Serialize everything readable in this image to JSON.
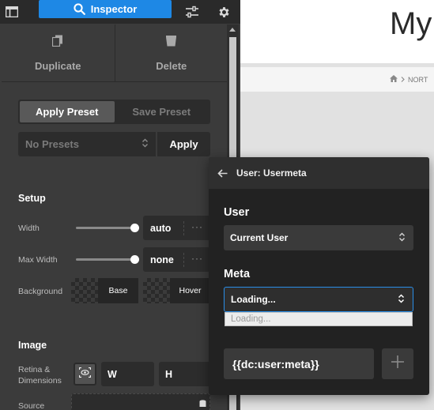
{
  "topbar": {
    "layout_icon": "layout-icon",
    "inspector_label": "Inspector",
    "sliders_icon": "sliders-icon",
    "gear_icon": "gear-icon"
  },
  "actions": {
    "duplicate_label": "Duplicate",
    "delete_label": "Delete"
  },
  "presets": {
    "apply_tab": "Apply Preset",
    "save_tab": "Save Preset",
    "select_value": "No Presets",
    "apply_button": "Apply"
  },
  "setup": {
    "heading": "Setup",
    "width_label": "Width",
    "width_value": "auto",
    "max_width_label": "Max Width",
    "max_width_value": "none",
    "more_dots": "···",
    "background_label": "Background",
    "base_label": "Base",
    "hover_label": "Hover"
  },
  "image": {
    "heading": "Image",
    "retina_label": "Retina & Dimensions",
    "w_placeholder": "W",
    "h_placeholder": "H",
    "source_label": "Source"
  },
  "canvas": {
    "title_partial": "My",
    "crumb_partial": "NORT"
  },
  "popover": {
    "title": "User: Usermeta",
    "user_label": "User",
    "user_value": "Current User",
    "meta_label": "Meta",
    "meta_value": "Loading...",
    "meta_option": "Loading...",
    "tag_value": "{{dc:user:meta}}"
  },
  "colors": {
    "accent": "#1e88e5",
    "panel_bg": "#3b3b3b",
    "popover_bg": "#222222"
  }
}
